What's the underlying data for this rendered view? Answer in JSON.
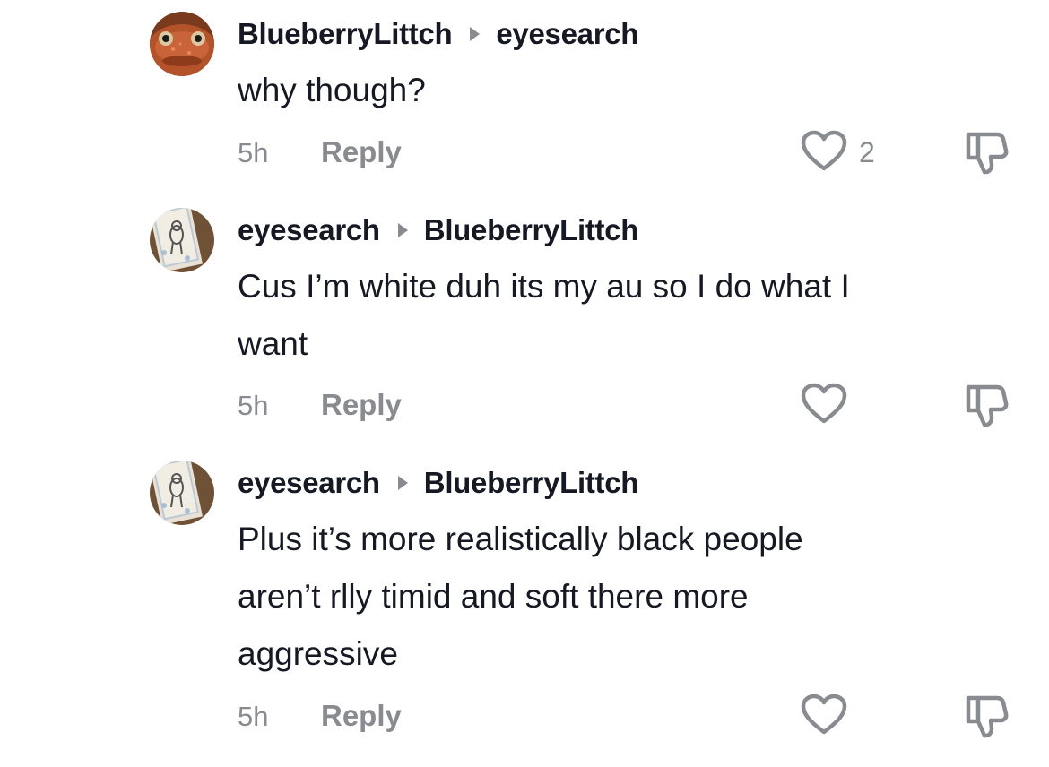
{
  "comments": [
    {
      "author": "BlueberryLittch",
      "reply_to": "eyesearch",
      "avatar_icon": "frog-avatar",
      "text_lines": [
        "why though?"
      ],
      "time": "5h",
      "reply_label": "Reply",
      "like_count": "2"
    },
    {
      "author": "eyesearch",
      "reply_to": "BlueberryLittch",
      "avatar_icon": "cat-sketch-avatar",
      "text_lines": [
        "Cus I’m white duh its my au so I do what I",
        "want"
      ],
      "time": "5h",
      "reply_label": "Reply",
      "like_count": ""
    },
    {
      "author": "eyesearch",
      "reply_to": "BlueberryLittch",
      "avatar_icon": "cat-sketch-avatar",
      "text_lines": [
        "Plus it’s more realistically black people",
        "aren’t rlly timid and soft there more",
        "aggressive"
      ],
      "time": "5h",
      "reply_label": "Reply",
      "like_count": ""
    }
  ],
  "colors": {
    "text_primary": "#161823",
    "text_secondary": "#8a8b91",
    "icon": "#8a8b91",
    "background": "#ffffff"
  }
}
